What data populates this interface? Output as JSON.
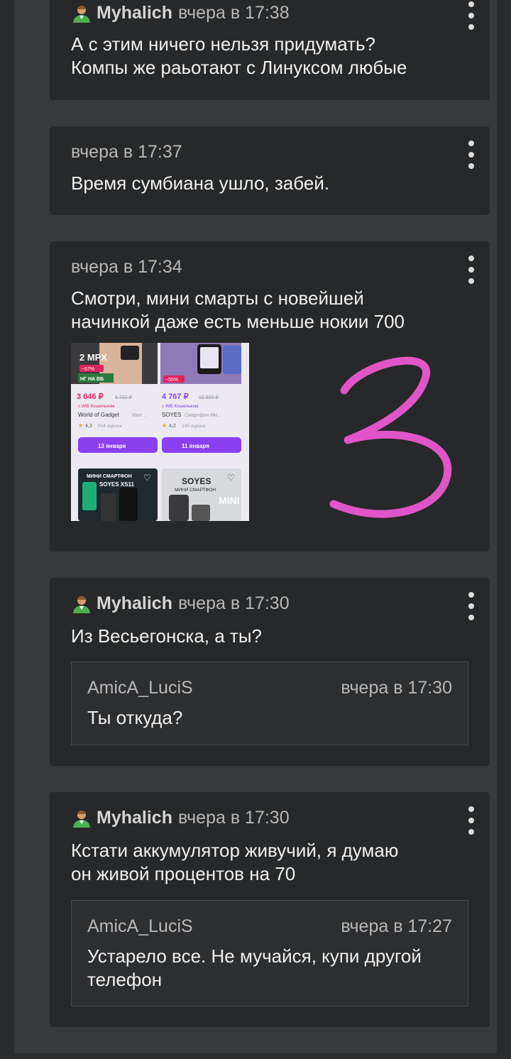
{
  "messages": [
    {
      "author": "Myhalich",
      "time": "вчера в 17:38",
      "text_lines": [
        "А с этим ничего нельзя придумать?",
        "Компы же раьотают с Линуксом любые"
      ]
    },
    {
      "time": "вчера в 17:37",
      "text": "Время сумбиана ушло, забей."
    },
    {
      "time": "вчера в 17:34",
      "text_lines": [
        "Смотри, мини смарты с новейшей",
        "начинкой даже есть меньше нокии 700"
      ],
      "attachment": {
        "products": [
          {
            "price": "3 646 ₽",
            "old_price": "8 700 ₽",
            "wallet": "с WB Кошельком",
            "brand": "World of Gadget",
            "category": "Мал...",
            "rating": "4,3",
            "reviews": "814 оценок",
            "delivery": "13 января",
            "badge": "НГ НА ВБ",
            "discount": "−57%",
            "camera": "2 МPX"
          },
          {
            "price": "4 767 ₽",
            "old_price": "10 900 ₽",
            "wallet": "с WB Кошельком",
            "brand": "SOYES",
            "category": "Смартфон Ми...",
            "rating": "4,2",
            "reviews": "140 оценок",
            "delivery": "11 января",
            "discount": "−55%"
          }
        ],
        "banners": [
          "МИНИ СМАРТФОН",
          "SOYES XS11",
          "SOYES",
          "МИНИ СМАРТФОН",
          "MINI"
        ],
        "annotation": "3"
      }
    },
    {
      "author": "Myhalich",
      "time": "вчера в 17:30",
      "text": "Из Весьегонска, а ты?",
      "quote": {
        "author": "AmicA_LuciS",
        "time": "вчера в 17:30",
        "text": "Ты откуда?"
      }
    },
    {
      "author": "Myhalich",
      "time": "вчера в 17:30",
      "text_lines": [
        "Кстати аккумулятор живучий, я думаю",
        "он живой процентов на 70"
      ],
      "quote": {
        "author": "AmicA_LuciS",
        "time": "вчера в 17:27",
        "text_lines": [
          "Устарело все. Не мучайся, купи другой",
          "телефон"
        ]
      }
    }
  ],
  "icons": {
    "user": "user-avatar-icon",
    "menu": "more-vert-icon",
    "cart": "cart-icon",
    "heart": "heart-icon"
  },
  "colors": {
    "background": "#2a2b2d",
    "panel": "#38393b",
    "card": "#272829",
    "annotation": "#e055c8",
    "delivery_button": "#8a3ff0"
  }
}
